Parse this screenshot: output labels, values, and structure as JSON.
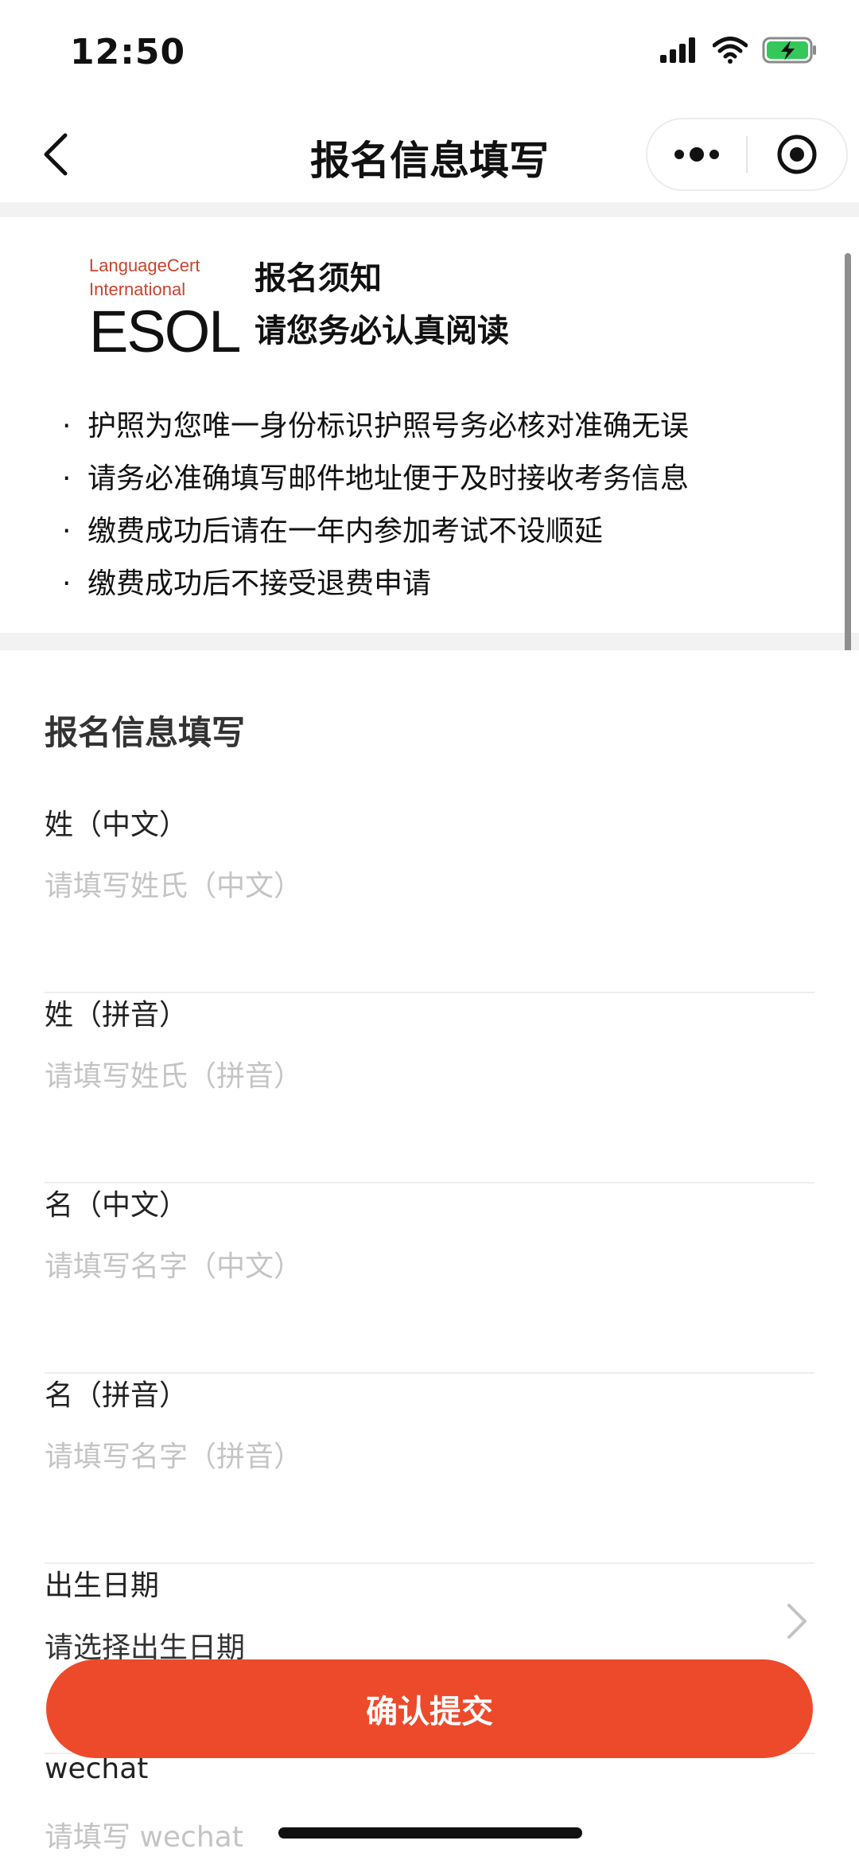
{
  "status_bar": {
    "time": "12:50"
  },
  "nav": {
    "title": "报名信息填写"
  },
  "notice": {
    "logo_line1": "LanguageCert",
    "logo_line2": "International",
    "logo_big": "ESOL",
    "title": "报名须知",
    "subtitle": "请您务必认真阅读",
    "bullet": "·",
    "items": [
      "护照为您唯一身份标识护照号务必核对准确无误",
      "请务必准确填写邮件地址便于及时接收考务信息",
      "缴费成功后请在一年内参加考试不设顺延",
      "缴费成功后不接受退费申请"
    ]
  },
  "form": {
    "heading": "报名信息填写",
    "fields": [
      {
        "label": "姓（中文）",
        "placeholder": "请填写姓氏（中文）"
      },
      {
        "label": "姓（拼音）",
        "placeholder": "请填写姓氏（拼音）"
      },
      {
        "label": "名（中文）",
        "placeholder": "请填写名字（中文）"
      },
      {
        "label": "名（拼音）",
        "placeholder": "请填写名字（拼音）"
      },
      {
        "label": "出生日期",
        "value": "请选择出生日期"
      },
      {
        "label": "wechat",
        "placeholder": "请填写 wechat"
      }
    ]
  },
  "submit": {
    "label": "确认提交"
  },
  "colors": {
    "accent": "#ec4a2b",
    "battery": "#34c759",
    "logo_red": "#c9432f"
  }
}
